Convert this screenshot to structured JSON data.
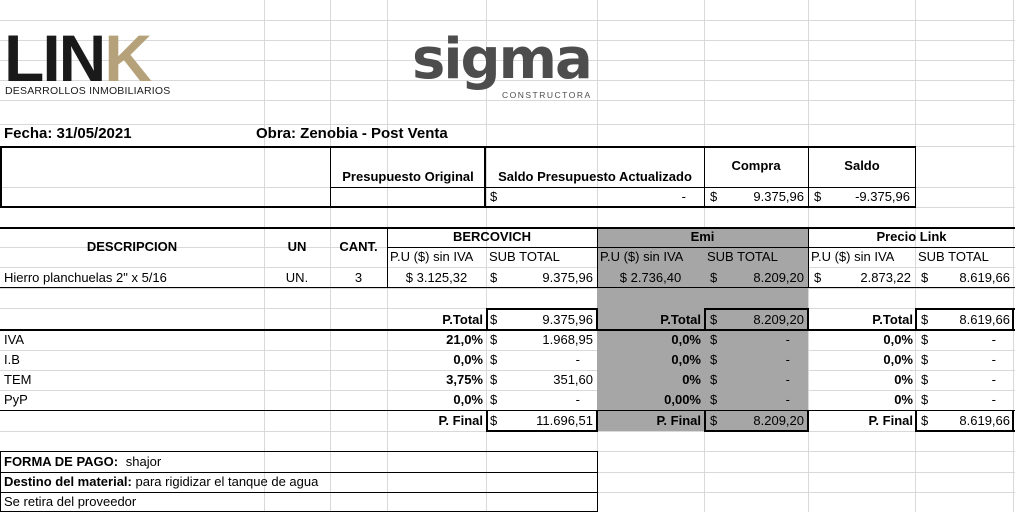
{
  "logos": {
    "link_main": "LIN",
    "link_k": "K",
    "link_sub": "DESARROLLOS INMOBILIARIOS",
    "sigma_a": "sig",
    "sigma_b": "ma",
    "sigma_sub": "CONSTRUCTORA"
  },
  "header": {
    "fecha": "Fecha: 31/05/2021",
    "obra": "Obra: Zenobia - Post Venta"
  },
  "budget": {
    "original_label": "Presupuesto Original",
    "saldo_actualizado_label": "Saldo Presupuesto Actualizado",
    "compra_label": "Compra",
    "saldo_label": "Saldo",
    "saldo_actualizado_currency": "$",
    "saldo_actualizado_value": "-",
    "compra_currency": "$",
    "compra_value": "9.375,96",
    "saldo_currency": "$",
    "saldo_value": "-9.375,96"
  },
  "table": {
    "col_descripcion": "DESCRIPCION",
    "col_un": "UN",
    "col_cant": "CANT.",
    "suppliers": [
      {
        "name": "BERCOVICH",
        "pu_label": "P.U ($) sin IVA",
        "sub_label": "SUB TOTAL"
      },
      {
        "name": "Emi",
        "pu_label": "P.U ($) sin IVA",
        "sub_label": "SUB TOTAL"
      },
      {
        "name": "Precio Link",
        "pu_label": "P.U ($) sin IVA",
        "sub_label": "SUB TOTAL"
      }
    ],
    "item": {
      "descripcion": "Hierro planchuelas 2\" x 5/16",
      "un": "UN.",
      "cant": "3",
      "s1_pu": "$ 3.125,32",
      "s1_cur": "$",
      "s1_sub": "9.375,96",
      "s2_pu": "$ 2.736,40",
      "s2_cur": "$",
      "s2_sub": "8.209,20",
      "s3_cur_pu": "$",
      "s3_pu": "2.873,22",
      "s3_cur": "$",
      "s3_sub": "8.619,66"
    }
  },
  "totals": {
    "ptotal_label": "P.Total",
    "pfinal_label": "P. Final",
    "currency": "$",
    "s1_ptotal": "9.375,96",
    "s2_ptotal": "8.209,20",
    "s3_ptotal": "8.619,66",
    "rows": [
      {
        "label": "IVA",
        "s1_pct": "21,0%",
        "s1_val": "1.968,95",
        "s2_pct": "0,0%",
        "s2_val": "-",
        "s3_pct": "0,0%",
        "s3_val": "-"
      },
      {
        "label": "I.B",
        "s1_pct": "0,0%",
        "s1_val": "-",
        "s2_pct": "0,0%",
        "s2_val": "-",
        "s3_pct": "0,0%",
        "s3_val": "-"
      },
      {
        "label": "TEM",
        "s1_pct": "3,75%",
        "s1_val": "351,60",
        "s2_pct": "0%",
        "s2_val": "-",
        "s3_pct": "0%",
        "s3_val": "-"
      },
      {
        "label": "PyP",
        "s1_pct": "0,0%",
        "s1_val": "-",
        "s2_pct": "0,00%",
        "s2_val": "-",
        "s3_pct": "0%",
        "s3_val": "-"
      }
    ],
    "s1_pfinal": "11.696,51",
    "s2_pfinal": "8.209,20",
    "s3_pfinal": "8.619,66"
  },
  "footer": {
    "forma_pago_label": "FORMA DE PAGO:",
    "forma_pago_value": "shajor",
    "destino_label": "Destino del material:",
    "destino_value": "para rigidizar el tanque de agua",
    "retiro": "Se retira del proveedor"
  }
}
